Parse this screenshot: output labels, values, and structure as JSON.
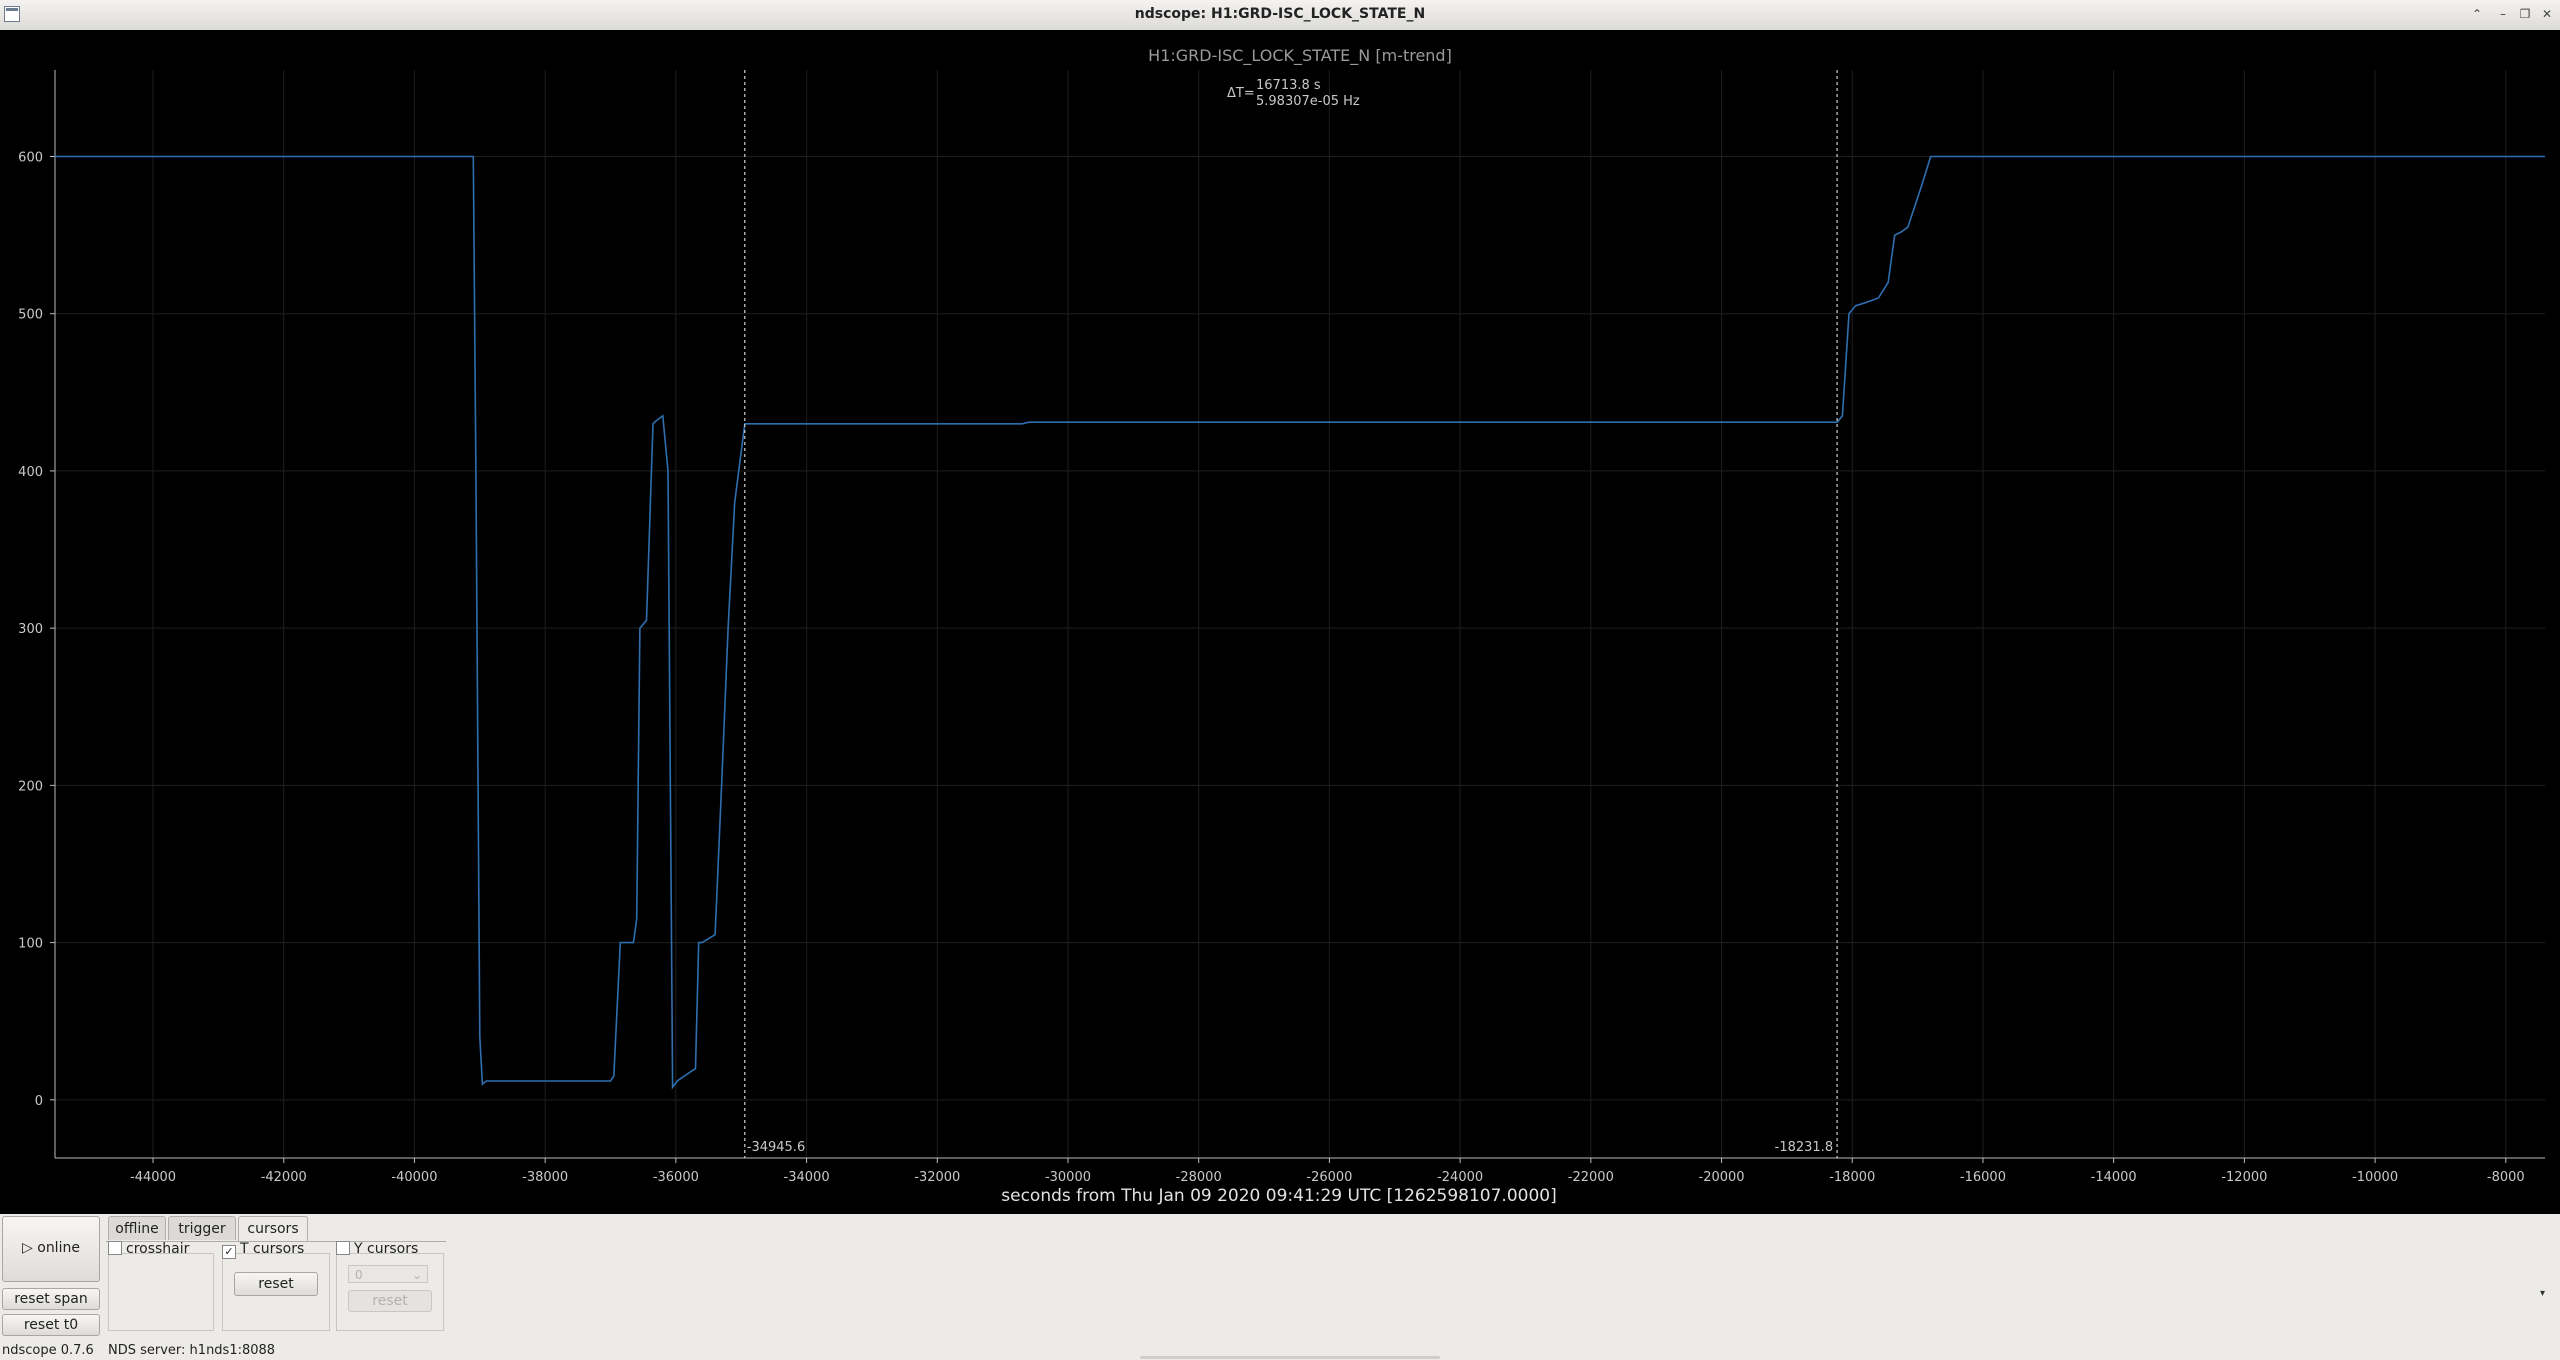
{
  "window": {
    "title": "ndscope: H1:GRD-ISC_LOCK_STATE_N",
    "controls": [
      "⌃",
      "–",
      "❐",
      "✕"
    ]
  },
  "plot": {
    "title": "H1:GRD-ISC_LOCK_STATE_N [m-trend]",
    "delta_label": "ΔT=",
    "delta_t": "16713.8 s",
    "delta_f": "5.98307e-05 Hz",
    "xlabel": "seconds from Thu Jan 09 2020 09:41:29 UTC [1262598107.0000]",
    "cursor1_label": "-34945.6",
    "cursor2_label": "-18231.8",
    "colors": {
      "background": "#000000",
      "trace": "#2f6fb0",
      "grid": "#1f1f1f",
      "cursor": "#d0d0d0"
    }
  },
  "chart_data": {
    "type": "line",
    "title": "H1:GRD-ISC_LOCK_STATE_N [m-trend]",
    "xlabel": "seconds from Thu Jan 09 2020 09:41:29 UTC [1262598107.0000]",
    "ylabel": "",
    "xlim": [
      -45500,
      -7400
    ],
    "ylim": [
      -37,
      655
    ],
    "xticks": [
      -44000,
      -42000,
      -40000,
      -38000,
      -36000,
      -34000,
      -32000,
      -30000,
      -28000,
      -26000,
      -24000,
      -22000,
      -20000,
      -18000,
      -16000,
      -14000,
      -12000,
      -10000,
      -8000
    ],
    "yticks": [
      0,
      100,
      200,
      300,
      400,
      500,
      600
    ],
    "grid": true,
    "cursors": [
      -34945.6,
      -18231.8
    ],
    "series": [
      {
        "x": [
          -45500,
          -39100,
          -39060,
          -39000,
          -38960,
          -38900,
          -37000,
          -36950,
          -36850,
          -36650,
          -36600,
          -36550,
          -36450,
          -36350,
          -36300,
          -36200,
          -36120,
          -36050,
          -35980,
          -35700,
          -35650,
          -35600,
          -35400,
          -35300,
          -35200,
          -35100,
          -34945.6,
          -30700,
          -30600,
          -18231.8,
          -18150,
          -18050,
          -17950,
          -17800,
          -17600,
          -17450,
          -17350,
          -17250,
          -17150,
          -16950,
          -16800,
          -16750,
          -7400
        ],
        "y": [
          600,
          600,
          400,
          40,
          10,
          12,
          12,
          15,
          100,
          100,
          115,
          300,
          305,
          430,
          432,
          435,
          400,
          8,
          12,
          20,
          100,
          100,
          105,
          200,
          300,
          380,
          430,
          430,
          431,
          431,
          435,
          500,
          505,
          507,
          510,
          520,
          550,
          552,
          555,
          580,
          600,
          600,
          600
        ]
      }
    ]
  },
  "controls": {
    "online_label": "▷ online",
    "reset_span_label": "reset span",
    "reset_t0_label": "reset t0",
    "tabs": [
      "offline",
      "trigger",
      "cursors"
    ],
    "crosshair_label": "crosshair",
    "t_cursors_label": "T cursors",
    "t_cursors_check": "✓",
    "y_cursors_label": "Y cursors",
    "t_reset_label": "reset",
    "y_select_value": "0",
    "y_reset_label": "reset",
    "expand_arrow": "▾"
  },
  "status": {
    "version": "ndscope 0.7.6",
    "server": "NDS server: h1nds1:8088"
  }
}
